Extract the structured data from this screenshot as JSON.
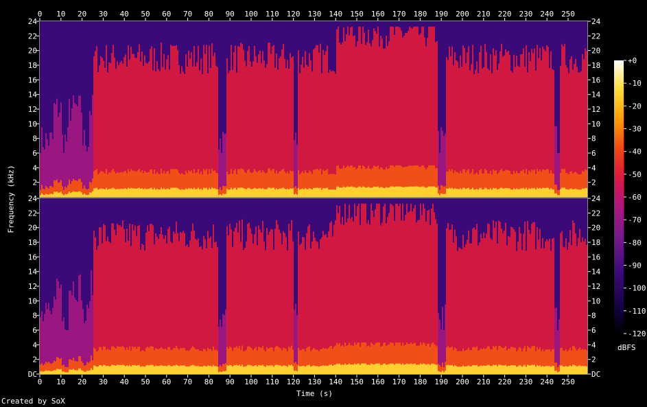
{
  "chart_data": {
    "type": "heatmap",
    "title": "",
    "xlabel": "Time (s)",
    "ylabel": "Frequency (kHz)",
    "xlim": [
      0,
      260
    ],
    "ylim_khz": [
      0,
      24
    ],
    "x_ticks": [
      0,
      10,
      20,
      30,
      40,
      50,
      60,
      70,
      80,
      90,
      100,
      110,
      120,
      130,
      140,
      150,
      160,
      170,
      180,
      190,
      200,
      210,
      220,
      230,
      240,
      250
    ],
    "y_ticks_top": [
      "24",
      "22",
      "20",
      "18",
      "16",
      "14",
      "12",
      "10",
      "8",
      "6",
      "4",
      "2"
    ],
    "y_ticks_bottom": [
      "24",
      "22",
      "20",
      "18",
      "16",
      "14",
      "12",
      "10",
      "8",
      "6",
      "4",
      "2",
      "DC"
    ],
    "channels": 2,
    "colorbar": {
      "label": "dBFS",
      "ticks": [
        "+0",
        "-10",
        "-20",
        "-30",
        "-40",
        "-50",
        "-60",
        "-70",
        "-80",
        "-90",
        "-100",
        "-110",
        "-120"
      ]
    },
    "credit": "Created by SoX"
  },
  "colors": {
    "background": "#000000",
    "colormap": [
      "#000000",
      "#14003a",
      "#3a0a7a",
      "#7a1a8e",
      "#b4167a",
      "#e01a3c",
      "#f04a14",
      "#ff9a00",
      "#ffe040",
      "#ffffff"
    ]
  }
}
